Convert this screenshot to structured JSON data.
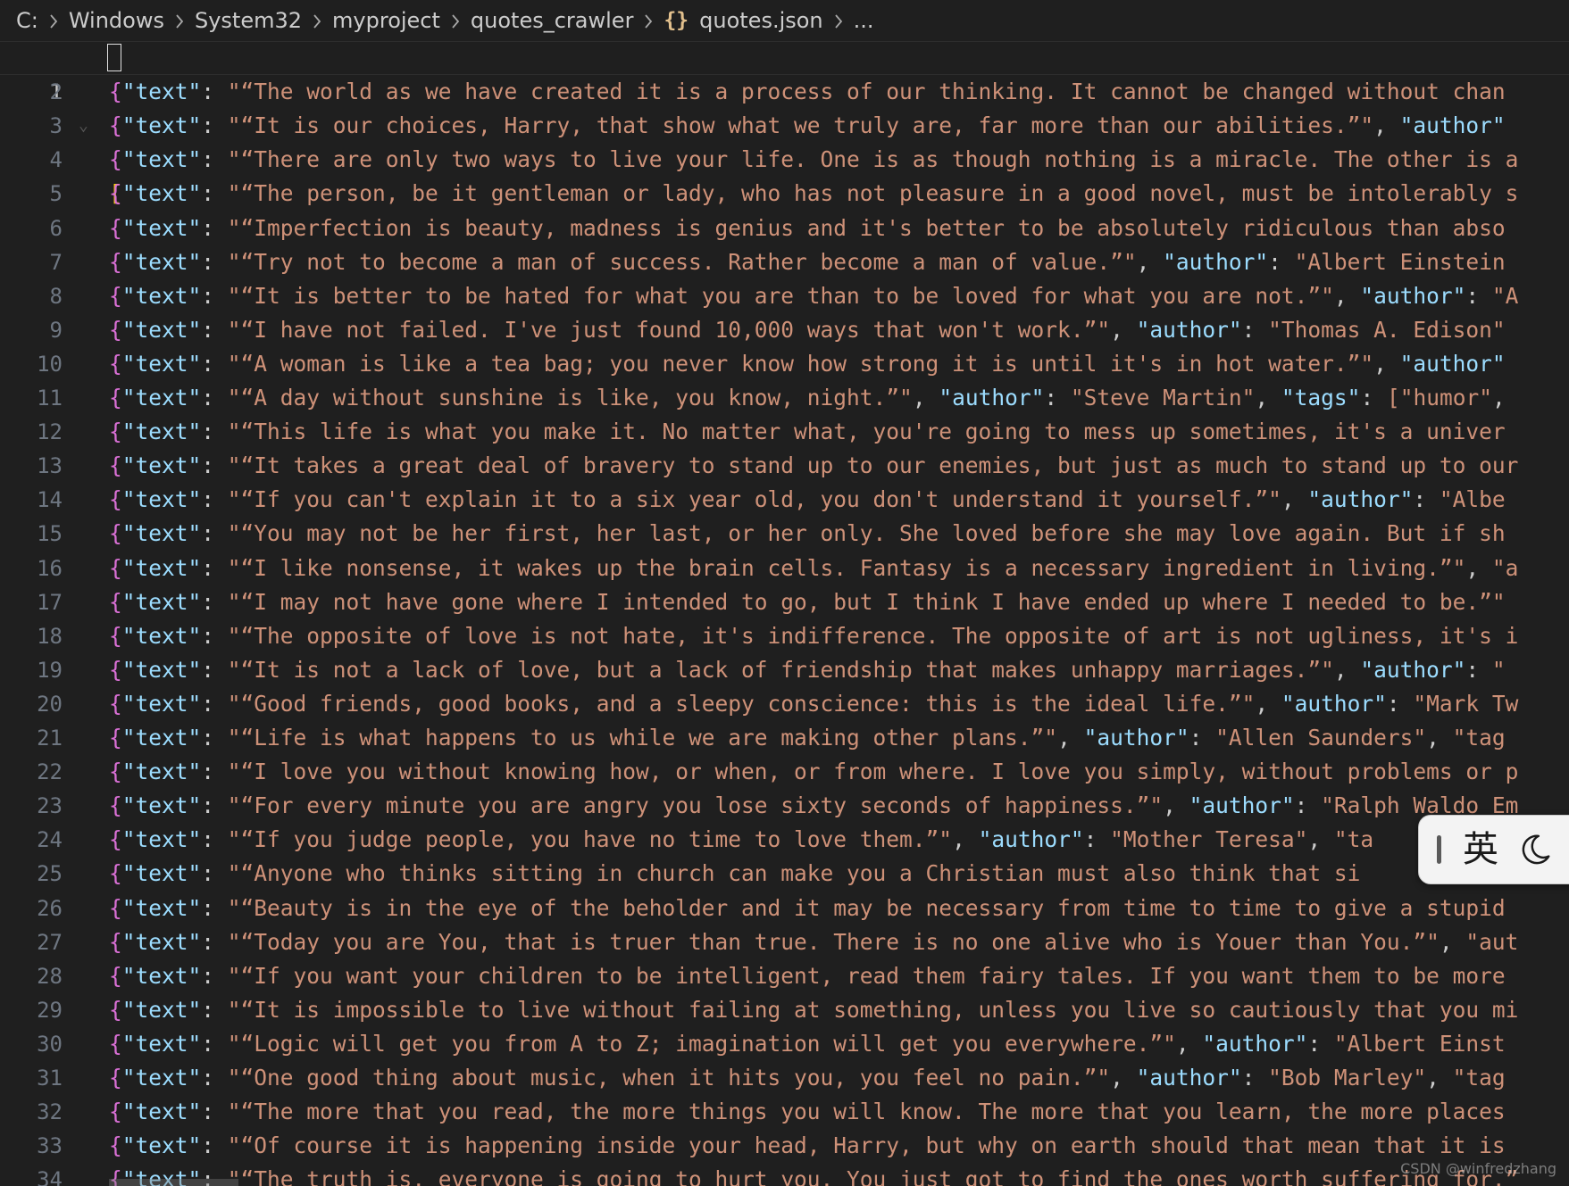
{
  "breadcrumb": {
    "items": [
      "C:",
      "Windows",
      "System32",
      "myproject",
      "quotes_crawler",
      "quotes.json",
      "..."
    ],
    "file_icon": "{}"
  },
  "editor": {
    "first_line": "[",
    "key_name": "\"text\"",
    "lines": [
      {
        "n": "2",
        "rest": "\"“The world as we have created it is a process of our thinking. It cannot be changed without chan"
      },
      {
        "n": "3",
        "rest": "\"“It is our choices, Harry, that show what we truly are, far more than our abilities.”\", \"author\""
      },
      {
        "n": "4",
        "rest": "\"“There are only two ways to live your life. One is as though nothing is a miracle. The other is a"
      },
      {
        "n": "5",
        "rest": "\"“The person, be it gentleman or lady, who has not pleasure in a good novel, must be intolerably s"
      },
      {
        "n": "6",
        "rest": "\"“Imperfection is beauty, madness is genius and it's better to be absolutely ridiculous than abso"
      },
      {
        "n": "7",
        "rest": "\"“Try not to become a man of success. Rather become a man of value.”\", \"author\": \"Albert Einstein"
      },
      {
        "n": "8",
        "rest": "\"“It is better to be hated for what you are than to be loved for what you are not.”\", \"author\": \"A"
      },
      {
        "n": "9",
        "rest": "\"“I have not failed. I've just found 10,000 ways that won't work.”\", \"author\": \"Thomas A. Edison\""
      },
      {
        "n": "10",
        "rest": "\"“A woman is like a tea bag; you never know how strong it is until it's in hot water.”\", \"author\""
      },
      {
        "n": "11",
        "rest": "\"“A day without sunshine is like, you know, night.”\", \"author\": \"Steve Martin\", \"tags\": [\"humor\","
      },
      {
        "n": "12",
        "rest": "\"“This life is what you make it. No matter what, you're going to mess up sometimes, it's a univer"
      },
      {
        "n": "13",
        "rest": "\"“It takes a great deal of bravery to stand up to our enemies, but just as much to stand up to our"
      },
      {
        "n": "14",
        "rest": "\"“If you can't explain it to a six year old, you don't understand it yourself.”\", \"author\": \"Albe"
      },
      {
        "n": "15",
        "rest": "\"“You may not be her first, her last, or her only. She loved before she may love again. But if sh"
      },
      {
        "n": "16",
        "rest": "\"“I like nonsense, it wakes up the brain cells. Fantasy is a necessary ingredient in living.”\", \"a"
      },
      {
        "n": "17",
        "rest": "\"“I may not have gone where I intended to go, but I think I have ended up where I needed to be.”\""
      },
      {
        "n": "18",
        "rest": "\"“The opposite of love is not hate, it's indifference. The opposite of art is not ugliness, it's i"
      },
      {
        "n": "19",
        "rest": "\"“It is not a lack of love, but a lack of friendship that makes unhappy marriages.”\", \"author\": \""
      },
      {
        "n": "20",
        "rest": "\"“Good friends, good books, and a sleepy conscience: this is the ideal life.”\", \"author\": \"Mark Tw"
      },
      {
        "n": "21",
        "rest": "\"“Life is what happens to us while we are making other plans.”\", \"author\": \"Allen Saunders\", \"tag"
      },
      {
        "n": "22",
        "rest": "\"“I love you without knowing how, or when, or from where. I love you simply, without problems or p"
      },
      {
        "n": "23",
        "rest": "\"“For every minute you are angry you lose sixty seconds of happiness.”\", \"author\": \"Ralph Waldo Em"
      },
      {
        "n": "24",
        "rest": "\"“If you judge people, you have no time to love them.”\", \"author\": \"Mother Teresa\", \"ta"
      },
      {
        "n": "25",
        "rest": "\"“Anyone who thinks sitting in church can make you a Christian must also think that si"
      },
      {
        "n": "26",
        "rest": "\"“Beauty is in the eye of the beholder and it may be necessary from time to time to give a stupid"
      },
      {
        "n": "27",
        "rest": "\"“Today you are You, that is truer than true. There is no one alive who is Youer than You.”\", \"aut"
      },
      {
        "n": "28",
        "rest": "\"“If you want your children to be intelligent, read them fairy tales. If you want them to be more"
      },
      {
        "n": "29",
        "rest": "\"“It is impossible to live without failing at something, unless you live so cautiously that you mi"
      },
      {
        "n": "30",
        "rest": "\"“Logic will get you from A to Z; imagination will get you everywhere.”\", \"author\": \"Albert Einst"
      },
      {
        "n": "31",
        "rest": "\"“One good thing about music, when it hits you, you feel no pain.”\", \"author\": \"Bob Marley\", \"tag"
      },
      {
        "n": "32",
        "rest": "\"“The more that you read, the more things you will know. The more that you learn, the more places"
      },
      {
        "n": "33",
        "rest": "\"“Of course it is happening inside your head, Harry, but why on earth should that mean that it is"
      },
      {
        "n": "34",
        "rest": "\"“The truth is, everyone is going to hurt you. You just got to find the ones worth suffering for.”"
      }
    ]
  },
  "ime": {
    "lang": "英",
    "mode_icon": "moon-icon"
  },
  "watermark": "CSDN @winfredzhang",
  "colors": {
    "background": "#1f1f1f",
    "key": "#9cdcfe",
    "string": "#ce9178",
    "bracket_yellow": "#ffd700",
    "bracket_purple": "#da70d6",
    "bracket_blue": "#179fff",
    "line_number": "#6e7681"
  }
}
